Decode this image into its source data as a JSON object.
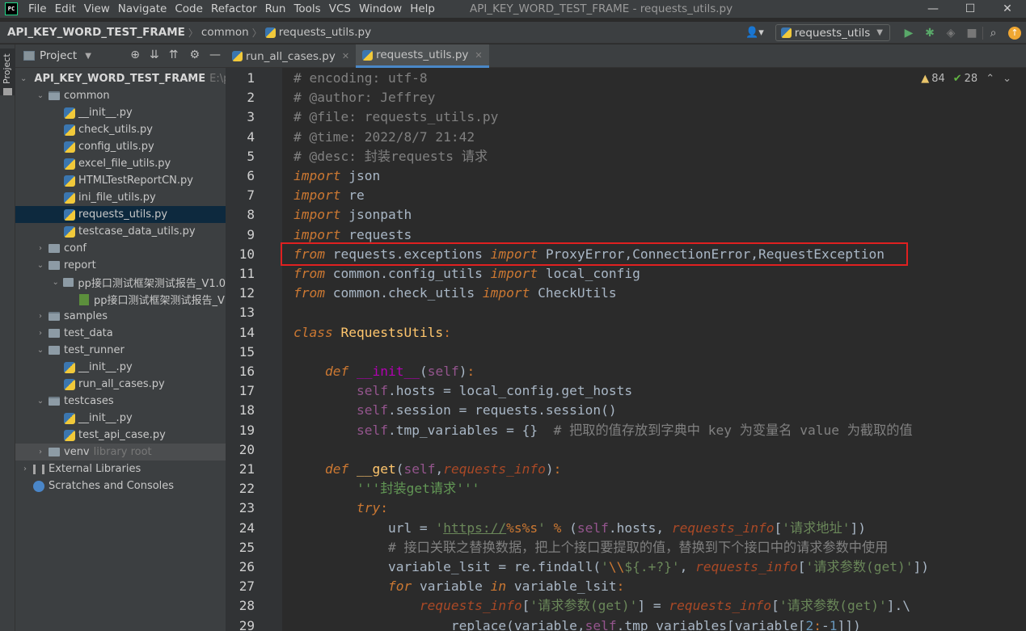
{
  "menubar": {
    "logo_text": "PC",
    "items": [
      "File",
      "Edit",
      "View",
      "Navigate",
      "Code",
      "Refactor",
      "Run",
      "Tools",
      "VCS",
      "Window",
      "Help"
    ],
    "title": "API_KEY_WORD_TEST_FRAME - requests_utils.py",
    "controls": [
      "—",
      "☐",
      "✕"
    ]
  },
  "navbar": {
    "project": "API_KEY_WORD_TEST_FRAME",
    "folder": "common",
    "file": "requests_utils.py",
    "run_config": "requests_utils"
  },
  "toolstrip": {
    "label": "Project"
  },
  "project_panel": {
    "title": "Project",
    "tree": [
      {
        "label": "API_KEY_WORD_TEST_FRAME",
        "suffix": "E:\\p",
        "depth": 0,
        "chev": "⌄",
        "kind": "dir",
        "bold": true
      },
      {
        "label": "common",
        "suffix": "",
        "depth": 1,
        "chev": "⌄",
        "kind": "pkg"
      },
      {
        "label": "__init__.py",
        "suffix": "",
        "depth": 2,
        "chev": "",
        "kind": "py"
      },
      {
        "label": "check_utils.py",
        "suffix": "",
        "depth": 2,
        "chev": "",
        "kind": "py"
      },
      {
        "label": "config_utils.py",
        "suffix": "",
        "depth": 2,
        "chev": "",
        "kind": "py"
      },
      {
        "label": "excel_file_utils.py",
        "suffix": "",
        "depth": 2,
        "chev": "",
        "kind": "py"
      },
      {
        "label": "HTMLTestReportCN.py",
        "suffix": "",
        "depth": 2,
        "chev": "",
        "kind": "py"
      },
      {
        "label": "ini_file_utils.py",
        "suffix": "",
        "depth": 2,
        "chev": "",
        "kind": "py"
      },
      {
        "label": "requests_utils.py",
        "suffix": "",
        "depth": 2,
        "chev": "",
        "kind": "py",
        "selected": true
      },
      {
        "label": "testcase_data_utils.py",
        "suffix": "",
        "depth": 2,
        "chev": "",
        "kind": "py"
      },
      {
        "label": "conf",
        "suffix": "",
        "depth": 1,
        "chev": "›",
        "kind": "dir"
      },
      {
        "label": "report",
        "suffix": "",
        "depth": 1,
        "chev": "⌄",
        "kind": "dir"
      },
      {
        "label": "pp接口测试框架测试报告_V1.0",
        "suffix": "",
        "depth": 2,
        "chev": "⌄",
        "kind": "dir"
      },
      {
        "label": "pp接口测试框架测试报告_V",
        "suffix": "",
        "depth": 3,
        "chev": "",
        "kind": "html"
      },
      {
        "label": "samples",
        "suffix": "",
        "depth": 1,
        "chev": "›",
        "kind": "pkg"
      },
      {
        "label": "test_data",
        "suffix": "",
        "depth": 1,
        "chev": "›",
        "kind": "dir"
      },
      {
        "label": "test_runner",
        "suffix": "",
        "depth": 1,
        "chev": "⌄",
        "kind": "dir"
      },
      {
        "label": "__init__.py",
        "suffix": "",
        "depth": 2,
        "chev": "",
        "kind": "py"
      },
      {
        "label": "run_all_cases.py",
        "suffix": "",
        "depth": 2,
        "chev": "",
        "kind": "py"
      },
      {
        "label": "testcases",
        "suffix": "",
        "depth": 1,
        "chev": "⌄",
        "kind": "pkg"
      },
      {
        "label": "__init__.py",
        "suffix": "",
        "depth": 2,
        "chev": "",
        "kind": "py"
      },
      {
        "label": "test_api_case.py",
        "suffix": "",
        "depth": 2,
        "chev": "",
        "kind": "py"
      },
      {
        "label": "venv",
        "suffix": "library root",
        "depth": 1,
        "chev": "›",
        "kind": "dir",
        "hover": true
      },
      {
        "label": "External Libraries",
        "suffix": "",
        "depth": 0,
        "chev": "›",
        "kind": "lib"
      },
      {
        "label": "Scratches and Consoles",
        "suffix": "",
        "depth": 0,
        "chev": "",
        "kind": "scratch"
      }
    ]
  },
  "editor_tabs": [
    {
      "label": "run_all_cases.py",
      "active": false
    },
    {
      "label": "requests_utils.py",
      "active": true
    }
  ],
  "inspections": {
    "warnings": "84",
    "weak_warnings": "28"
  },
  "code_lines": [
    "# encoding: utf-8",
    "# @author: Jeffrey",
    "# @file: requests_utils.py",
    "# @time: 2022/8/7 21:42",
    "# @desc: 封装requests 请求",
    "import json",
    "import re",
    "import jsonpath",
    "import requests",
    "from requests.exceptions import ProxyError,ConnectionError,RequestException",
    "from common.config_utils import local_config",
    "from common.check_utils import CheckUtils",
    "",
    "class RequestsUtils:",
    "",
    "    def __init__(self):",
    "        self.hosts = local_config.get_hosts",
    "        self.session = requests.session()",
    "        self.tmp_variables = {}  # 把取的值存放到字典中 key 为变量名 value 为截取的值",
    "",
    "    def __get(self,requests_info):",
    "        '''封装get请求'''",
    "        try:",
    "            url = 'https://%s%s' % (self.hosts, requests_info['请求地址'])",
    "            # 接口关联之替换数据，把上个接口要提取的值，替换到下个接口中的请求参数中使用",
    "            variable_lsit = re.findall('\\\\${.+?}', requests_info['请求参数(get)'])",
    "            for variable in variable_lsit:",
    "                requests_info['请求参数(get)'] = requests_info['请求参数(get)'].\\",
    "                    replace(variable,self.tmp_variables[variable[2:-1]])"
  ],
  "colors": {
    "keyword": "#cc7832",
    "string": "#6a8759",
    "comment": "#808080",
    "self": "#94558d",
    "function": "#ffc66d",
    "param": "#aa4926",
    "highlight_box": "#e02020"
  },
  "icons": [
    "pycharm-logo",
    "user-icon",
    "run-icon",
    "debug-icon",
    "coverage-icon",
    "stop-icon",
    "search-icon",
    "update-icon",
    "gear-icon",
    "collapse-icon",
    "expand-icon",
    "target-icon",
    "minimize-icon",
    "warning-icon",
    "check-icon"
  ]
}
